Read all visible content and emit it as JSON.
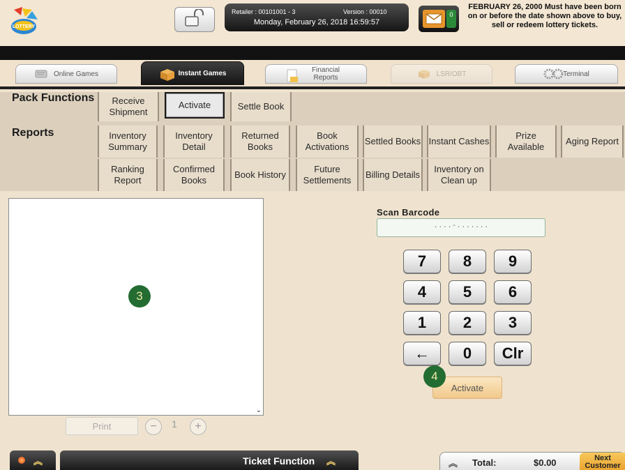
{
  "header": {
    "logo_icon": "lottery-logo-icon",
    "lock_icon": "unlock-icon",
    "retailer_text": "Retailer : 00101001 - 3",
    "version_text": "Version : 00010",
    "datetime": "Monday, February 26, 2018 16:59:57",
    "mail_icon": "mail-icon",
    "message_count": "0",
    "age_notice": "FEBRUARY 26, 2000 Must have been born on or before the date shown above to buy, sell or redeem lottery tickets."
  },
  "main_tabs": [
    {
      "label": "Online Games",
      "icon": "online-games-icon",
      "state": "normal"
    },
    {
      "label": "Instant Games",
      "icon": "box-icon",
      "state": "active"
    },
    {
      "label": "Financial Reports",
      "icon": "report-icon",
      "state": "normal"
    },
    {
      "label": "LSR/OBT",
      "icon": "package-icon",
      "state": "disabled"
    },
    {
      "label": "Terminal",
      "icon": "gears-icon",
      "state": "normal"
    }
  ],
  "pack_functions": {
    "label": "Pack Functions",
    "buttons": [
      "Receive Shipment",
      "Activate",
      "Settle Book"
    ],
    "active": "Activate"
  },
  "reports": {
    "label": "Reports",
    "row1": [
      "Inventory Summary",
      "Inventory Detail",
      "Returned Books",
      "Book Activations",
      "Settled Books",
      "Instant Cashes",
      "Prize Available",
      "Aging Report"
    ],
    "row2": [
      "Ranking Report",
      "Confirmed Books",
      "Book History",
      "Future Settlements",
      "Billing Details",
      "Inventory on Clean up"
    ]
  },
  "list_panel": {
    "badge": "3",
    "print_label": "Print",
    "minus": "−",
    "plus": "+",
    "copies": "1"
  },
  "scan": {
    "label": "Scan Barcode",
    "placeholder": "....-......."
  },
  "keypad": {
    "keys": [
      "7",
      "8",
      "9",
      "4",
      "5",
      "6",
      "1",
      "2",
      "3",
      "←",
      "0",
      "Clr"
    ]
  },
  "activate": {
    "badge": "4",
    "label": "Activate"
  },
  "bottom": {
    "ticket_function": "Ticket Function",
    "total_label": "Total:",
    "total_value": "$0.00",
    "next_customer": "Next Customer"
  },
  "colors": {
    "background": "#efe3cf",
    "panel": "#dcd0bd",
    "badge": "#236c32",
    "activate": "#f1c98b",
    "accent_orange": "#e7952b"
  }
}
